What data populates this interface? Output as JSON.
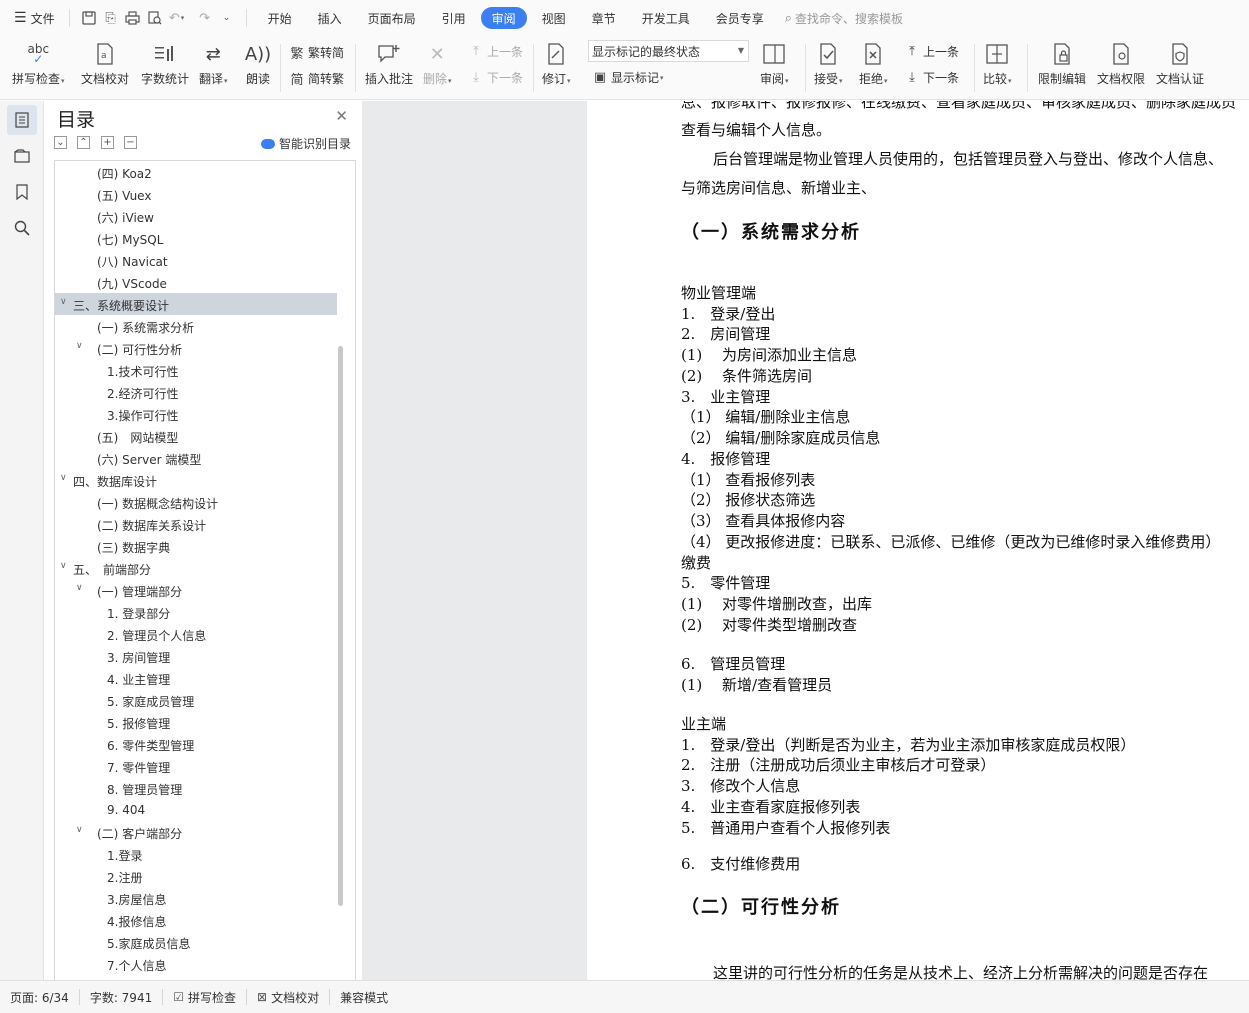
{
  "menubar": {
    "file_label": "文件",
    "tabs": [
      {
        "label": "开始",
        "active": false
      },
      {
        "label": "插入",
        "active": false
      },
      {
        "label": "页面布局",
        "active": false
      },
      {
        "label": "引用",
        "active": false
      },
      {
        "label": "审阅",
        "active": true
      },
      {
        "label": "视图",
        "active": false
      },
      {
        "label": "章节",
        "active": false
      },
      {
        "label": "开发工具",
        "active": false
      },
      {
        "label": "会员专享",
        "active": false
      }
    ],
    "search_placeholder": "查找命令、搜索模板"
  },
  "ribbon": {
    "spellcheck": "拼写检查",
    "doc_proof": "文档校对",
    "word_count": "字数统计",
    "translate": "翻译",
    "read_aloud": "朗读",
    "to_traditional": "繁转简",
    "to_simplified": "简转繁",
    "insert_comment": "插入批注",
    "delete": "删除",
    "prev": "上一条",
    "next": "下一条",
    "revise": "修订",
    "markup_state": "显示标记的最终状态",
    "show_markup": "显示标记",
    "review": "审阅",
    "accept": "接受",
    "reject": "拒绝",
    "prev2": "上一条",
    "next2": "下一条",
    "compare": "比较",
    "restrict_edit": "限制编辑",
    "doc_rights": "文档权限",
    "doc_cert": "文档认证"
  },
  "toc": {
    "title": "目录",
    "smart_label": "智能识别目录",
    "items": [
      {
        "text": "(四) Koa2",
        "indent": 2,
        "toggle": ""
      },
      {
        "text": "(五) Vuex",
        "indent": 2,
        "toggle": ""
      },
      {
        "text": "(六) iView",
        "indent": 2,
        "toggle": ""
      },
      {
        "text": "(七) MySQL",
        "indent": 2,
        "toggle": ""
      },
      {
        "text": "(八) Navicat",
        "indent": 2,
        "toggle": ""
      },
      {
        "text": "(九) VScode",
        "indent": 2,
        "toggle": ""
      },
      {
        "text": "三、系统概要设计",
        "indent": 1,
        "toggle": "v",
        "selected": true
      },
      {
        "text": "(一) 系统需求分析",
        "indent": 2,
        "toggle": ""
      },
      {
        "text": "(二) 可行性分析",
        "indent": 2,
        "toggle": "v"
      },
      {
        "text": "1.技术可行性",
        "indent": 3,
        "toggle": ""
      },
      {
        "text": "2.经济可行性",
        "indent": 3,
        "toggle": ""
      },
      {
        "text": "3.操作可行性",
        "indent": 3,
        "toggle": ""
      },
      {
        "text": "(五)　网站模型",
        "indent": 2,
        "toggle": ""
      },
      {
        "text": "(六) Server 端模型",
        "indent": 2,
        "toggle": ""
      },
      {
        "text": "四、数据库设计",
        "indent": 1,
        "toggle": "v"
      },
      {
        "text": "(一) 数据概念结构设计",
        "indent": 2,
        "toggle": ""
      },
      {
        "text": "(二) 数据库关系设计",
        "indent": 2,
        "toggle": ""
      },
      {
        "text": "(三) 数据字典",
        "indent": 2,
        "toggle": ""
      },
      {
        "text": "五、　前端部分",
        "indent": 1,
        "toggle": "v"
      },
      {
        "text": "(一) 管理端部分",
        "indent": 2,
        "toggle": "v"
      },
      {
        "text": "1. 登录部分",
        "indent": 3,
        "toggle": ""
      },
      {
        "text": "2. 管理员个人信息",
        "indent": 3,
        "toggle": ""
      },
      {
        "text": "3. 房间管理",
        "indent": 3,
        "toggle": ""
      },
      {
        "text": "4. 业主管理",
        "indent": 3,
        "toggle": ""
      },
      {
        "text": "5. 家庭成员管理",
        "indent": 3,
        "toggle": ""
      },
      {
        "text": "5. 报修管理",
        "indent": 3,
        "toggle": ""
      },
      {
        "text": "6. 零件类型管理",
        "indent": 3,
        "toggle": ""
      },
      {
        "text": "7. 零件管理",
        "indent": 3,
        "toggle": ""
      },
      {
        "text": "8. 管理员管理",
        "indent": 3,
        "toggle": ""
      },
      {
        "text": "9. 404",
        "indent": 3,
        "toggle": ""
      },
      {
        "text": "(二) 客户端部分",
        "indent": 2,
        "toggle": "v"
      },
      {
        "text": "1.登录",
        "indent": 3,
        "toggle": ""
      },
      {
        "text": "2.注册",
        "indent": 3,
        "toggle": ""
      },
      {
        "text": "3.房屋信息",
        "indent": 3,
        "toggle": ""
      },
      {
        "text": "4.报修信息",
        "indent": 3,
        "toggle": ""
      },
      {
        "text": "5.家庭成员信息",
        "indent": 3,
        "toggle": ""
      },
      {
        "text": "7.个人信息",
        "indent": 3,
        "toggle": ""
      }
    ]
  },
  "document": {
    "lines": [
      {
        "text": "息、报修取件、报修报修、在线缴费、查看家庭成员、审核家庭成员、删除家庭成员",
        "style": "cut"
      },
      {
        "text": "查看与编辑个人信息。",
        "style": "body"
      },
      {
        "text": "后台管理端是物业管理人员使用的，包括管理员登入与登出、修改个人信息、",
        "style": "indent"
      },
      {
        "text": "与筛选房间信息、新增业主、",
        "style": "body"
      },
      {
        "text": "（一）系统需求分析",
        "style": "h2"
      },
      {
        "text": "物业管理端",
        "style": "body"
      },
      {
        "text": "1.　登录/登出",
        "style": "body"
      },
      {
        "text": "2.　房间管理",
        "style": "body"
      },
      {
        "text": "(1)　 为房间添加业主信息",
        "style": "body"
      },
      {
        "text": "(2)　 条件筛选房间",
        "style": "body"
      },
      {
        "text": "3.　业主管理",
        "style": "body"
      },
      {
        "text": "（1）  编辑/删除业主信息",
        "style": "body"
      },
      {
        "text": "（2）  编辑/删除家庭成员信息",
        "style": "body"
      },
      {
        "text": "4.　报修管理",
        "style": "body"
      },
      {
        "text": "（1）  查看报修列表",
        "style": "body"
      },
      {
        "text": "（2）  报修状态筛选",
        "style": "body"
      },
      {
        "text": "（3）  查看具体报修内容",
        "style": "body"
      },
      {
        "text": "（4）  更改报修进度：已联系、已派修、已维修（更改为已维修时录入维修费用）",
        "style": "body"
      },
      {
        "text": "缴费",
        "style": "body"
      },
      {
        "text": "5.　零件管理",
        "style": "body"
      },
      {
        "text": "(1)　 对零件增删改查，出库",
        "style": "body"
      },
      {
        "text": "(2)　 对零件类型增删改查",
        "style": "body"
      },
      {
        "text": "6.　管理员管理",
        "style": "body"
      },
      {
        "text": "(1)　 新增/查看管理员",
        "style": "body"
      },
      {
        "text": "业主端",
        "style": "body"
      },
      {
        "text": "1.　登录/登出（判断是否为业主，若为业主添加审核家庭成员权限）",
        "style": "body"
      },
      {
        "text": "2.　注册（注册成功后须业主审核后才可登录）",
        "style": "body"
      },
      {
        "text": "3.　修改个人信息",
        "style": "body"
      },
      {
        "text": "4.　业主查看家庭报修列表",
        "style": "body"
      },
      {
        "text": "5.　普通用户查看个人报修列表",
        "style": "body"
      },
      {
        "text": "6.　支付维修费用",
        "style": "body"
      },
      {
        "text": "（二）可行性分析",
        "style": "h2"
      },
      {
        "text": "这里讲的可行性分析的任务是从技术上、经济上分析需解决的问题是否存在",
        "style": "indent"
      }
    ]
  },
  "status": {
    "page": "页面: 6/34",
    "words": "字数: 7941",
    "spellcheck": "拼写检查",
    "proof": "文档校对",
    "compat": "兼容模式"
  }
}
